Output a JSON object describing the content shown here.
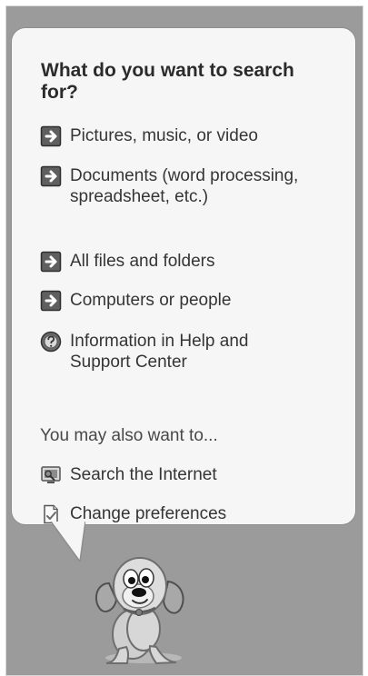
{
  "search_panel": {
    "question": "What do you want to search for?",
    "options": [
      {
        "label": "Pictures, music, or video",
        "icon": "arrow-right-icon"
      },
      {
        "label": "Documents (word processing, spreadsheet, etc.)",
        "icon": "arrow-right-icon"
      },
      {
        "label": "All files and folders",
        "icon": "arrow-right-icon"
      },
      {
        "label": "Computers or people",
        "icon": "arrow-right-icon"
      },
      {
        "label": "Information in Help and Support Center",
        "icon": "help-icon"
      }
    ],
    "also_heading": "You may also want to...",
    "also_options": [
      {
        "label": "Search the Internet",
        "icon": "internet-search-icon"
      },
      {
        "label": "Change preferences",
        "icon": "preferences-icon"
      }
    ]
  },
  "assistant": {
    "icon": "search-companion-dog-icon"
  },
  "colors": {
    "panel_background": "#9b9b9b",
    "bubble_background": "#f6f6f6",
    "text": "#353535",
    "question_text": "#2b2b2b"
  }
}
